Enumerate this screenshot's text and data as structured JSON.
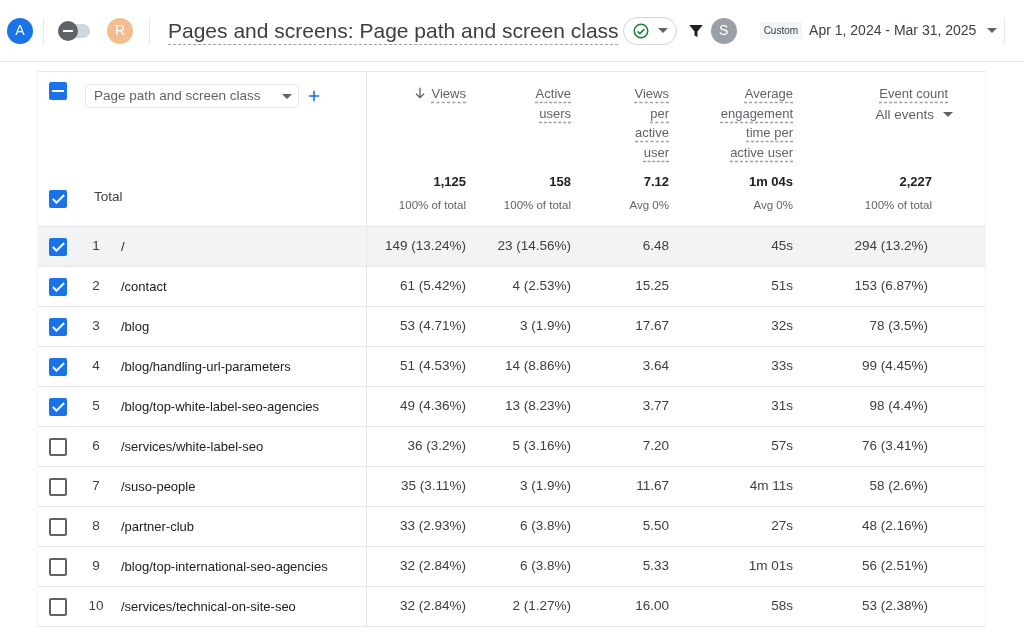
{
  "top_bar": {
    "avatars": [
      {
        "letter": "A",
        "color": "#1a73e8"
      },
      {
        "letter": "R",
        "color": "#f2bd8f"
      }
    ],
    "toggle": {
      "on": false
    },
    "title": "Pages and screens: Page path and screen class",
    "status_avatar": "S",
    "date_range": {
      "label": "Custom",
      "value": "Apr 1, 2024 - Mar 31, 2025"
    }
  },
  "table": {
    "select_all": {
      "checked": true,
      "indeterminate": true
    },
    "dimension": {
      "value": "Page path and screen class"
    },
    "columns": [
      {
        "label": "Views",
        "sorted": true
      },
      {
        "label": "Active users",
        "sorted": false
      },
      {
        "label": "Views per active user",
        "sorted": false
      },
      {
        "label": "Average engagement time per active user",
        "sorted": false
      },
      {
        "label": "Event count",
        "sorted": false,
        "filter": "All events"
      }
    ],
    "total": {
      "label": "Total",
      "checked": true,
      "cells": [
        {
          "value": "1,125",
          "note": "100% of total"
        },
        {
          "value": "158",
          "note": "100% of total"
        },
        {
          "value": "7.12",
          "note": "Avg 0%"
        },
        {
          "value": "1m 04s",
          "note": "Avg 0%"
        },
        {
          "value": "2,227",
          "note": "100% of total"
        }
      ]
    },
    "rows": [
      {
        "index": "1",
        "path": "/",
        "checked": true,
        "highlighted": true,
        "cells": [
          "149 (13.24%)",
          "23 (14.56%)",
          "6.48",
          "45s",
          "294 (13.2%)"
        ]
      },
      {
        "index": "2",
        "path": "/contact",
        "checked": true,
        "highlighted": false,
        "cells": [
          "61 (5.42%)",
          "4 (2.53%)",
          "15.25",
          "51s",
          "153 (6.87%)"
        ]
      },
      {
        "index": "3",
        "path": "/blog",
        "checked": true,
        "highlighted": false,
        "cells": [
          "53 (4.71%)",
          "3 (1.9%)",
          "17.67",
          "32s",
          "78 (3.5%)"
        ]
      },
      {
        "index": "4",
        "path": "/blog/handling-url-parameters",
        "checked": true,
        "highlighted": false,
        "cells": [
          "51 (4.53%)",
          "14 (8.86%)",
          "3.64",
          "33s",
          "99 (4.45%)"
        ]
      },
      {
        "index": "5",
        "path": "/blog/top-white-label-seo-agencies",
        "checked": true,
        "highlighted": false,
        "cells": [
          "49 (4.36%)",
          "13 (8.23%)",
          "3.77",
          "31s",
          "98 (4.4%)"
        ]
      },
      {
        "index": "6",
        "path": "/services/white-label-seo",
        "checked": false,
        "highlighted": false,
        "cells": [
          "36 (3.2%)",
          "5 (3.16%)",
          "7.20",
          "57s",
          "76 (3.41%)"
        ]
      },
      {
        "index": "7",
        "path": "/suso-people",
        "checked": false,
        "highlighted": false,
        "cells": [
          "35 (3.11%)",
          "3 (1.9%)",
          "11.67",
          "4m 11s",
          "58 (2.6%)"
        ]
      },
      {
        "index": "8",
        "path": "/partner-club",
        "checked": false,
        "highlighted": false,
        "cells": [
          "33 (2.93%)",
          "6 (3.8%)",
          "5.50",
          "27s",
          "48 (2.16%)"
        ]
      },
      {
        "index": "9",
        "path": "/blog/top-international-seo-agencies",
        "checked": false,
        "highlighted": false,
        "cells": [
          "32 (2.84%)",
          "6 (3.8%)",
          "5.33",
          "1m 01s",
          "56 (2.51%)"
        ]
      },
      {
        "index": "10",
        "path": "/services/technical-on-site-seo",
        "checked": false,
        "highlighted": false,
        "cells": [
          "32 (2.84%)",
          "2 (1.27%)",
          "16.00",
          "58s",
          "53 (2.38%)"
        ]
      }
    ]
  }
}
